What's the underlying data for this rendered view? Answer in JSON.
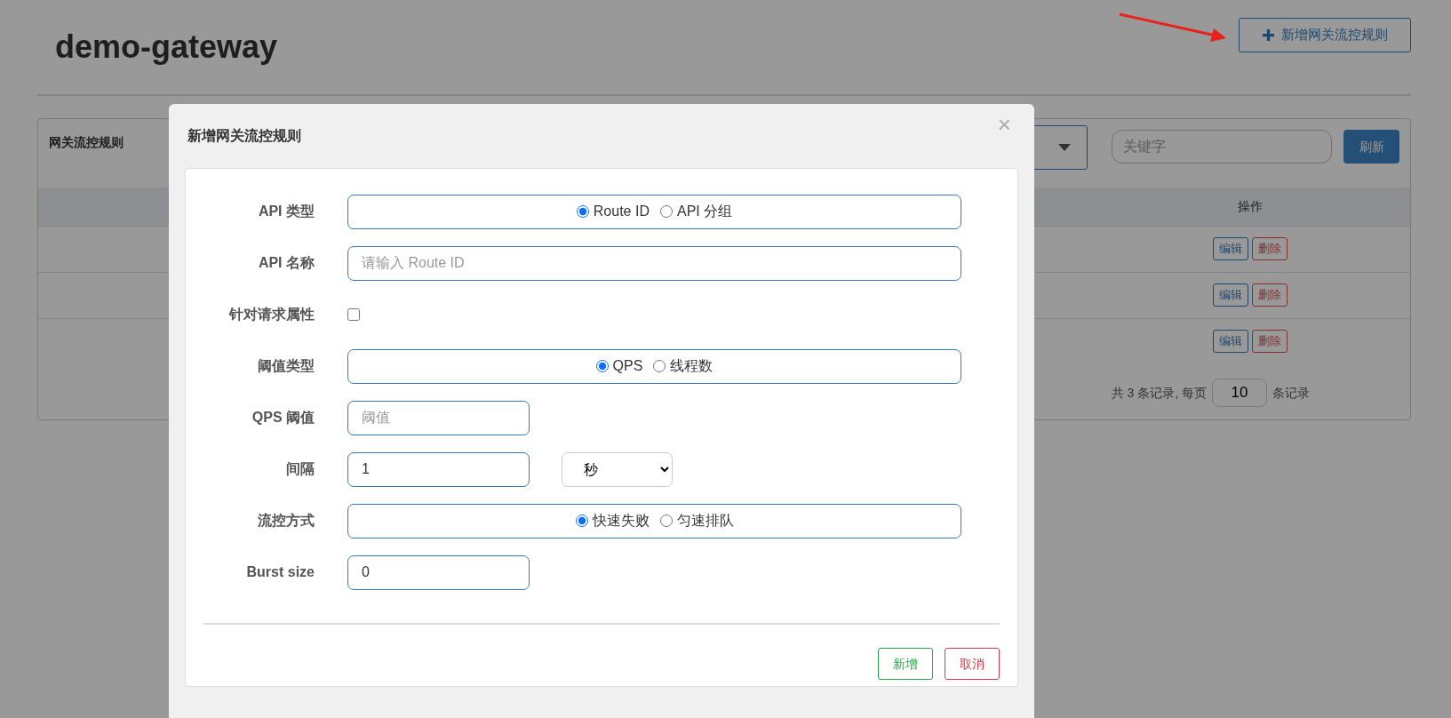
{
  "page": {
    "title": "demo-gateway",
    "add_button": "新增网关流控规则"
  },
  "rules_panel": {
    "title": "网关流控规则",
    "search": {
      "placeholder": "关键字"
    },
    "refresh_button": "刷新",
    "table": {
      "columns": [
        "操作"
      ],
      "rows": [
        {
          "actions": [
            "编辑",
            "删除"
          ]
        },
        {
          "actions": [
            "编辑",
            "删除"
          ]
        },
        {
          "actions": [
            "编辑",
            "删除"
          ]
        }
      ]
    },
    "pagination": {
      "prefix": "共 3 条记录, 每页",
      "page_size": "10",
      "suffix": "条记录"
    }
  },
  "modal": {
    "title": "新增网关流控规则",
    "close": "×",
    "fields": [
      {
        "kind": "radio",
        "label": "API 类型",
        "options": [
          {
            "label": "Route ID",
            "selected": true
          },
          {
            "label": "API 分组",
            "selected": false
          }
        ]
      },
      {
        "kind": "wide_text",
        "label": "API 名称",
        "placeholder": "请输入 Route ID"
      },
      {
        "kind": "checkbox",
        "label": "针对请求属性",
        "checked": false
      },
      {
        "kind": "radio",
        "label": "阈值类型",
        "options": [
          {
            "label": "QPS",
            "selected": true
          },
          {
            "label": "线程数",
            "selected": false
          }
        ]
      },
      {
        "kind": "text",
        "label": "QPS 阈值",
        "placeholder": "阈值"
      },
      {
        "kind": "text_select",
        "label": "间隔",
        "value": "1",
        "select": "秒"
      },
      {
        "kind": "radio",
        "label": "流控方式",
        "options": [
          {
            "label": "快速失败",
            "selected": true
          },
          {
            "label": "匀速排队",
            "selected": false
          }
        ]
      },
      {
        "kind": "text",
        "label": "Burst size",
        "value": "0"
      }
    ],
    "buttons": [
      {
        "label": "新增",
        "kind": "success"
      },
      {
        "label": "取消",
        "kind": "danger"
      }
    ]
  }
}
